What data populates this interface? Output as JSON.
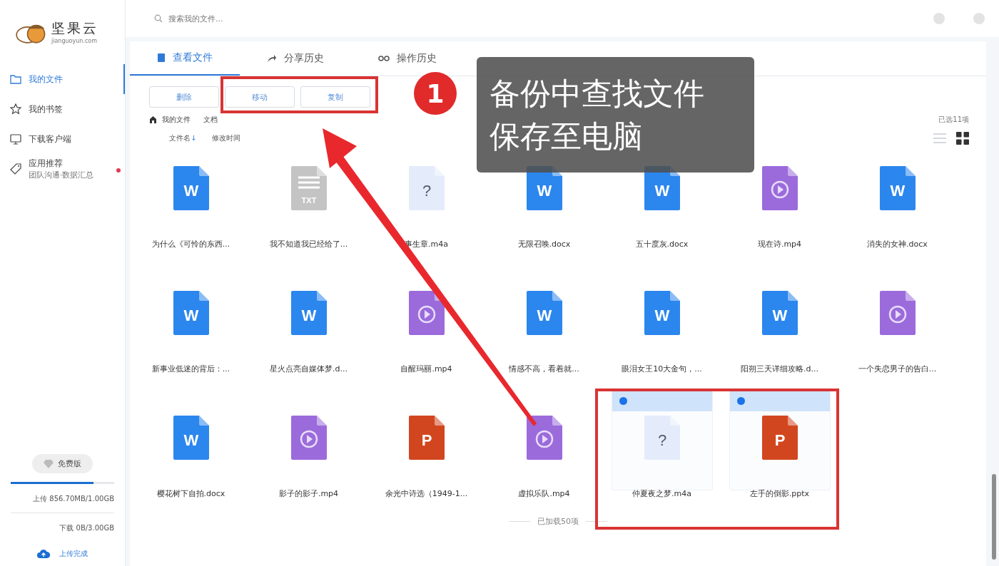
{
  "logo": {
    "name": "坚果云",
    "domain": "jianguoyun.com"
  },
  "search": {
    "placeholder": "搜索我的文件..."
  },
  "sidebar": {
    "items": [
      {
        "label": "我的文件",
        "kind": "folder",
        "selected": true
      },
      {
        "label": "我的书签",
        "kind": "star",
        "selected": false
      },
      {
        "label": "下载客户端",
        "kind": "monitor",
        "selected": false
      },
      {
        "label": "应用推荐",
        "sublabel": "团队沟通·数据汇总",
        "kind": "tag",
        "selected": false,
        "has_dot": true
      }
    ],
    "plan": "免费版",
    "storage": {
      "level": 0.8,
      "upload": "上传 856.70MB/1.00GB",
      "download": "下载 0B/3.00GB"
    },
    "status": "上传完成"
  },
  "tabs": [
    {
      "label": "查看文件",
      "kind": "doc",
      "selected": true
    },
    {
      "label": "分享历史",
      "kind": "share",
      "selected": false
    },
    {
      "label": "操作历史",
      "kind": "history",
      "selected": false
    }
  ],
  "actions": [
    "删除",
    "移动",
    "复制"
  ],
  "breadcrumb": [
    "我的文件",
    "文档"
  ],
  "selection_count": "已选11项",
  "sort": [
    {
      "label": "文件名",
      "arrow": "↓"
    },
    {
      "label": "修改时间"
    }
  ],
  "view_modes": [
    {
      "kind": "list",
      "selected": false
    },
    {
      "kind": "grid",
      "selected": true
    }
  ],
  "files": [
    {
      "name": "为什么《可怜的东西...",
      "kind": "word",
      "glyph": "W",
      "selected": false
    },
    {
      "name": "我不知道我已经给了...",
      "kind": "txt",
      "glyph": "TXT",
      "selected": false
    },
    {
      "name": "事生章.m4a",
      "kind": "unknown",
      "glyph": "?",
      "selected": false
    },
    {
      "name": "无限召唤.docx",
      "kind": "word",
      "glyph": "W",
      "selected": false
    },
    {
      "name": "五十度灰.docx",
      "kind": "word",
      "glyph": "W",
      "selected": false
    },
    {
      "name": "现在诗.mp4",
      "kind": "video",
      "selected": false
    },
    {
      "name": "消失的女神.docx",
      "kind": "word",
      "glyph": "W",
      "selected": false
    },
    {
      "name": "新事业低迷的背后：...",
      "kind": "word",
      "glyph": "W",
      "selected": false
    },
    {
      "name": "星火点亮自媒体梦.d...",
      "kind": "word",
      "glyph": "W",
      "selected": false
    },
    {
      "name": "自醒玛丽.mp4",
      "kind": "video",
      "selected": false
    },
    {
      "name": "情感不高，看着就...",
      "kind": "word",
      "glyph": "W",
      "selected": false
    },
    {
      "name": "眼泪女王10大金句，...",
      "kind": "word",
      "glyph": "W",
      "selected": false
    },
    {
      "name": "阳朔三天详细攻略.d...",
      "kind": "word",
      "glyph": "W",
      "selected": false
    },
    {
      "name": "一个失恋男子的告白...",
      "kind": "video",
      "selected": false
    },
    {
      "name": "樱花树下自拍.docx",
      "kind": "word",
      "glyph": "W",
      "selected": false
    },
    {
      "name": "影子的影子.mp4",
      "kind": "video",
      "selected": false
    },
    {
      "name": "余光中诗选（1949-1...",
      "kind": "ppt",
      "glyph": "P",
      "selected": false
    },
    {
      "name": "虚拟乐队.mp4",
      "kind": "video",
      "selected": false
    },
    {
      "name": "仲夏夜之梦.m4a",
      "kind": "unknown",
      "glyph": "?",
      "selected": true
    },
    {
      "name": "左手的倒影.pptx",
      "kind": "ppt",
      "glyph": "P",
      "selected": true
    }
  ],
  "footer": "已加载50项",
  "callout": {
    "number": "1",
    "lines": [
      "备份中查找文件",
      "保存至电脑"
    ]
  }
}
